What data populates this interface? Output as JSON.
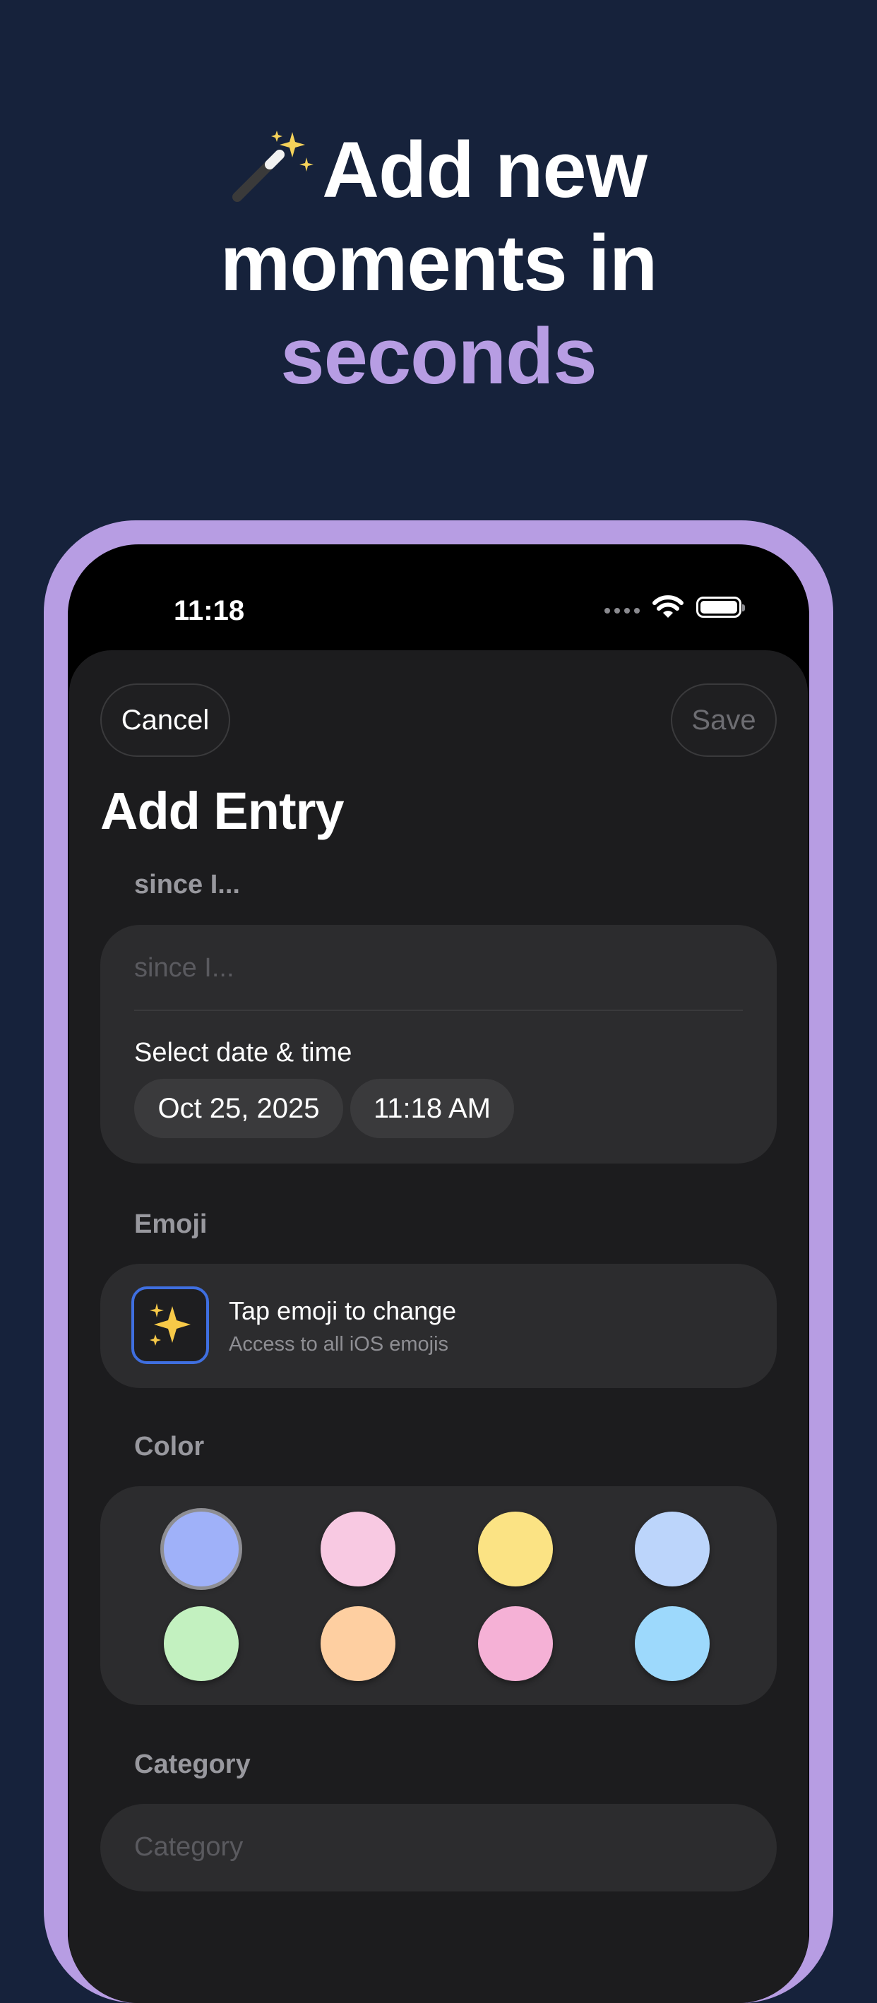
{
  "headline": {
    "line1": "Add new",
    "line2": "moments in",
    "line3": "seconds"
  },
  "status_bar": {
    "time": "11:18"
  },
  "sheet": {
    "cancel_label": "Cancel",
    "save_label": "Save",
    "title": "Add Entry",
    "since_label": "since I...",
    "since_placeholder": "since I...",
    "date_label": "Select date & time",
    "date_value": "Oct 25, 2025",
    "time_value": "11:18 AM",
    "emoji_label": "Emoji",
    "emoji_title": "Tap emoji to change",
    "emoji_subtitle": "Access to all iOS emojis",
    "color_label": "Color",
    "colors": [
      "#9fb1f9",
      "#f8c9e2",
      "#fbe384",
      "#bcd5fb",
      "#c3f1c0",
      "#fecfa1",
      "#f5b1d6",
      "#9dd9fc"
    ],
    "selected_color_index": 0,
    "category_label": "Category",
    "category_placeholder": "Category"
  },
  "theme": {
    "background": "#16223b",
    "accent": "#b79de3",
    "emoji_border": "#3f6fe0"
  }
}
